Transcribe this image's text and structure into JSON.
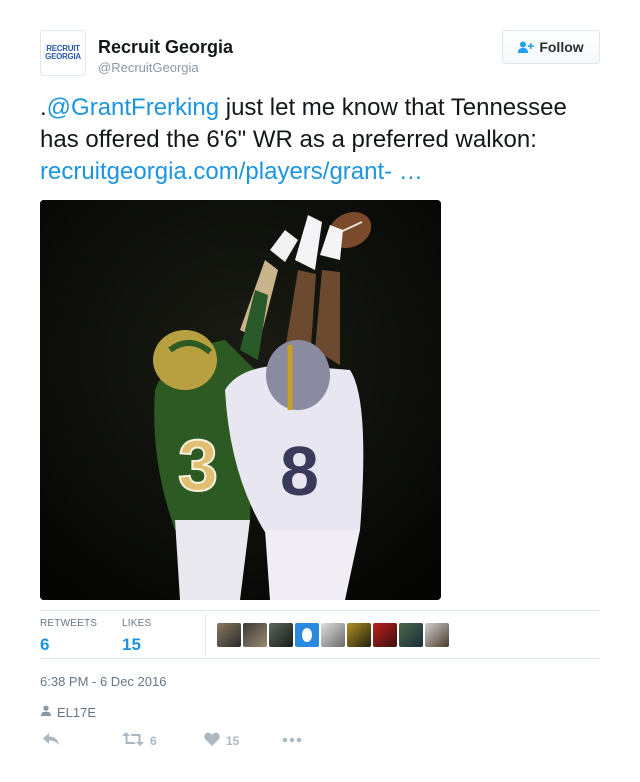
{
  "tweet": {
    "author": {
      "name": "Recruit Georgia",
      "handle": "@RecruitGeorgia",
      "avatar_line1": "RECRUIT",
      "avatar_line2": "GEORGIA"
    },
    "follow_label": "Follow",
    "text_prefix": ".",
    "mention": "@GrantFrerking",
    "text_body": " just let me know that Tennessee has offered the 6'6\" WR as a preferred walkon: ",
    "link": "recruitgeorgia.com/players/grant- …",
    "stats": {
      "retweets_label": "RETWEETS",
      "retweets": "6",
      "likes_label": "LIKES",
      "likes": "15"
    },
    "timestamp": "6:38 PM - 6 Dec 2016",
    "location": "EL17E",
    "actions": {
      "retweet_count": "6",
      "like_count": "15"
    }
  },
  "colors": {
    "link": "#1b95e0",
    "muted": "#657786",
    "icon": "#aab8c2"
  },
  "icons": [
    "follow-user-icon",
    "location-person-icon",
    "reply-icon",
    "retweet-icon",
    "heart-icon",
    "more-icon"
  ]
}
